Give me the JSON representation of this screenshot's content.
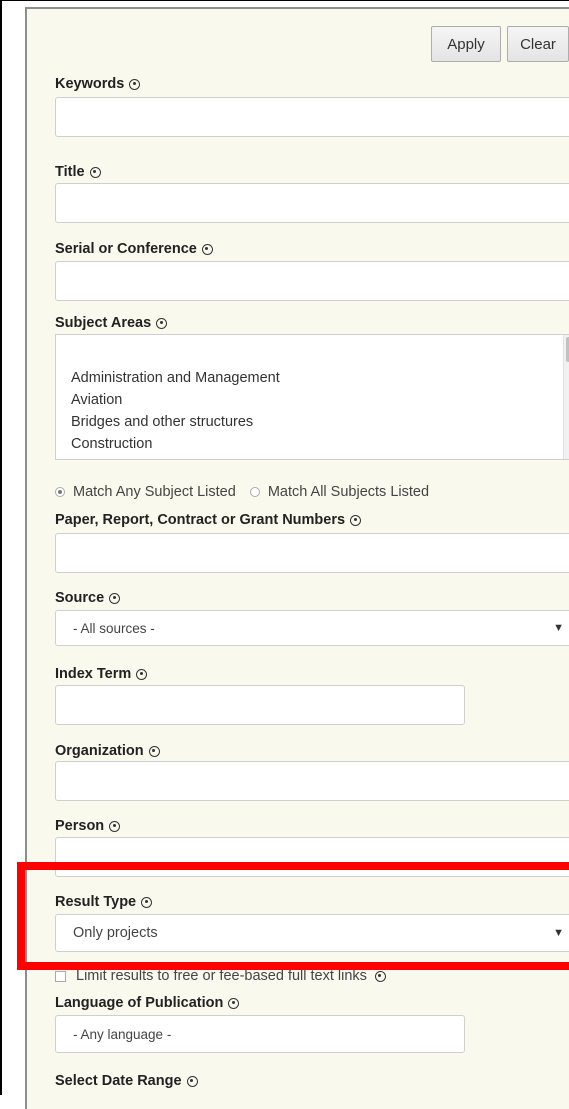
{
  "toolbar": {
    "apply_label": "Apply",
    "clear_label": "Clear"
  },
  "fields": {
    "keywords": {
      "label": "Keywords",
      "value": ""
    },
    "title": {
      "label": "Title",
      "value": ""
    },
    "serial": {
      "label": "Serial or Conference",
      "value": ""
    },
    "subject_areas": {
      "label": "Subject Areas",
      "items": [
        "Administration and Management",
        "Aviation",
        "Bridges and other structures",
        "Construction"
      ]
    },
    "match": {
      "any_label": "Match Any Subject Listed",
      "all_label": "Match All Subjects Listed",
      "selected": "any"
    },
    "numbers": {
      "label": "Paper, Report, Contract or Grant Numbers",
      "value": ""
    },
    "source": {
      "label": "Source",
      "selected": "- All sources -"
    },
    "index_term": {
      "label": "Index Term",
      "value": ""
    },
    "organization": {
      "label": "Organization",
      "value": ""
    },
    "person": {
      "label": "Person",
      "value": ""
    },
    "result_type": {
      "label": "Result Type",
      "selected": "Only projects"
    },
    "limit_results": {
      "label": "Limit results to free or fee-based full text links"
    },
    "language": {
      "label": "Language of Publication",
      "selected": "- Any language -"
    },
    "date_range": {
      "label": "Select Date Range"
    }
  },
  "colors": {
    "panel_bg": "#faf9ee",
    "highlight": "#ff0000"
  }
}
